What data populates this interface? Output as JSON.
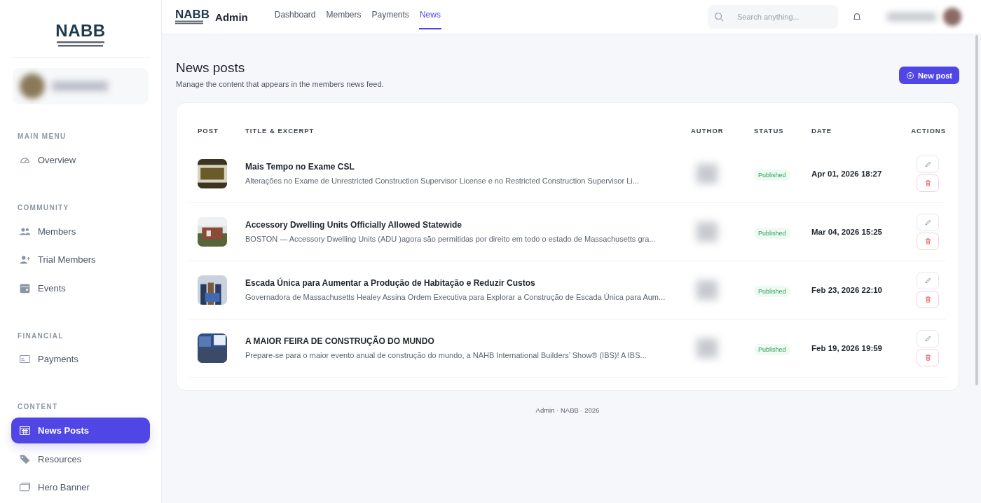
{
  "brand": {
    "logo": "NABB"
  },
  "sidebar": {
    "sections": [
      {
        "heading": "MAIN MENU",
        "items": [
          {
            "label": "Overview",
            "selected": false
          }
        ]
      },
      {
        "heading": "COMMUNITY",
        "items": [
          {
            "label": "Members",
            "selected": false
          },
          {
            "label": "Trial Members",
            "selected": false
          },
          {
            "label": "Events",
            "selected": false
          }
        ]
      },
      {
        "heading": "FINANCIAL",
        "items": [
          {
            "label": "Payments",
            "selected": false
          }
        ]
      },
      {
        "heading": "CONTENT",
        "items": [
          {
            "label": "News Posts",
            "selected": true
          },
          {
            "label": "Resources",
            "selected": false
          },
          {
            "label": "Hero Banner",
            "selected": false
          }
        ]
      }
    ]
  },
  "topbar": {
    "logo": "NABB",
    "app_name": "Admin",
    "tabs": [
      {
        "label": "Dashboard",
        "selected": false
      },
      {
        "label": "Members",
        "selected": false
      },
      {
        "label": "Payments",
        "selected": false
      },
      {
        "label": "News",
        "selected": true
      }
    ],
    "search": {
      "placeholder": "Search anything..."
    }
  },
  "page": {
    "title": "News posts",
    "subtitle": "Manage the content that appears in the members news feed.",
    "new_button": "New post"
  },
  "table": {
    "columns": [
      "POST",
      "TITLE & EXCERPT",
      "AUTHOR",
      "STATUS",
      "DATE",
      "ACTIONS"
    ],
    "rows": [
      {
        "title": "Mais Tempo no Exame CSL",
        "excerpt": "Alterações no Exame de Unrestricted Construction Supervisor License e no Restricted Construction Supervisor Li...",
        "status": "Published",
        "date": "Apr 01, 2026 18:27"
      },
      {
        "title": "Accessory Dwelling Units Officially Allowed Statewide",
        "excerpt": "BOSTON — Accessory Dwelling Units (ADU )agora são permitidas por direito em todo o estado de Massachusetts gra...",
        "status": "Published",
        "date": "Mar 04, 2026 15:25"
      },
      {
        "title": "Escada Única para Aumentar a Produção de Habitação e Reduzir Custos",
        "excerpt": "Governadora de Massachusetts Healey Assina Ordem Executiva para Explorar a Construção de Escada Única para Aum...",
        "status": "Published",
        "date": "Feb 23, 2026 22:10"
      },
      {
        "title": "A MAIOR FEIRA DE CONSTRUÇÃO DO MUNDO",
        "excerpt": "Prepare-se para o maior evento anual de construção do mundo, a NAHB International Builders’ Show® (IBS)! A IBS...",
        "status": "Published",
        "date": "Feb 19, 2026 19:59"
      }
    ]
  },
  "footer": "Admin · NABB · 2026"
}
